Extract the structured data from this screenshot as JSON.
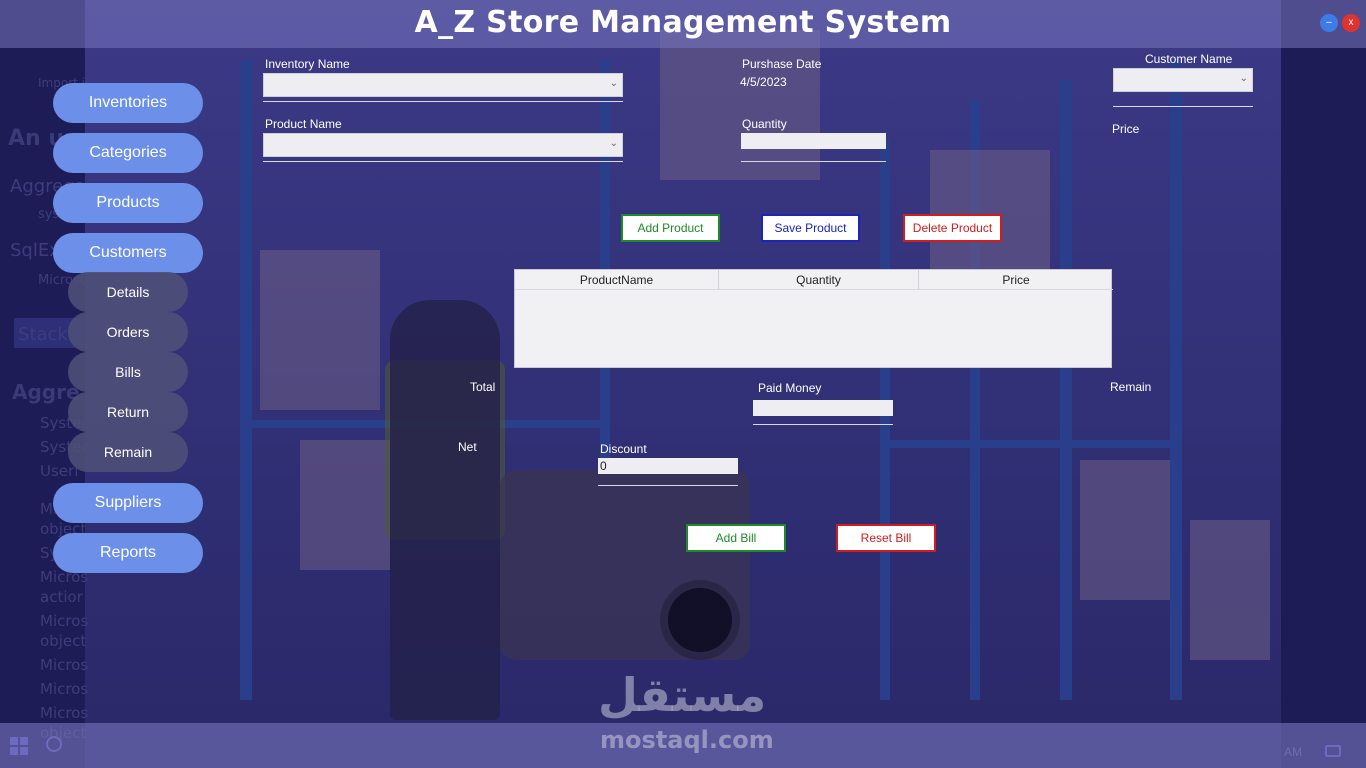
{
  "app": {
    "title": "A_Z Store Management System"
  },
  "window": {
    "minimize_label": "–",
    "close_label": "x"
  },
  "sidebar": {
    "items": [
      {
        "label": "Inventories"
      },
      {
        "label": "Categories"
      },
      {
        "label": "Products"
      },
      {
        "label": "Customers"
      }
    ],
    "customer_subitems": [
      {
        "label": "Details"
      },
      {
        "label": "Orders"
      },
      {
        "label": "Bills"
      },
      {
        "label": "Return"
      },
      {
        "label": "Remain"
      }
    ],
    "bottom_items": [
      {
        "label": "Suppliers"
      },
      {
        "label": "Reports"
      }
    ]
  },
  "form": {
    "inventory_name_label": "Inventory Name",
    "product_name_label": "Product Name",
    "purchase_date_label": "Purshase Date",
    "purchase_date_value": "4/5/2023",
    "quantity_label": "Quantity",
    "customer_name_label": "Customer Name",
    "price_label": "Price",
    "total_label": "Total",
    "net_label": "Net",
    "paid_money_label": "Paid Money",
    "remain_label": "Remain",
    "discount_label": "Discount",
    "discount_value": "0"
  },
  "buttons": {
    "add_product": "Add Product",
    "save_product": "Save Product",
    "delete_product": "Delete Product",
    "add_bill": "Add Bill",
    "reset_bill": "Reset Bill"
  },
  "grid": {
    "columns": [
      "ProductName",
      "Quantity",
      "Price"
    ],
    "rows": []
  },
  "taskbar": {
    "time": "AM"
  },
  "watermark": {
    "arabic": "مستقل",
    "latin": "mostaql.com"
  },
  "background_ghost_text": [
    "Import it",
    "An un",
    "Aggrega",
    "system.",
    "SqlExcep",
    "Microso",
    "Stack",
    "Aggre",
    "Syster",
    "Syster",
    "Useri",
    "Micros",
    "object",
    "Syster",
    "Micros",
    "actior",
    "Micros",
    "object",
    "Micros",
    "Micros",
    "Micros",
    "object"
  ],
  "colors": {
    "nav_button": "#6c8fea",
    "sub_button": "#4e5078",
    "green": "#1f8a2a",
    "blue": "#1d22b8",
    "red": "#d01d1d"
  }
}
